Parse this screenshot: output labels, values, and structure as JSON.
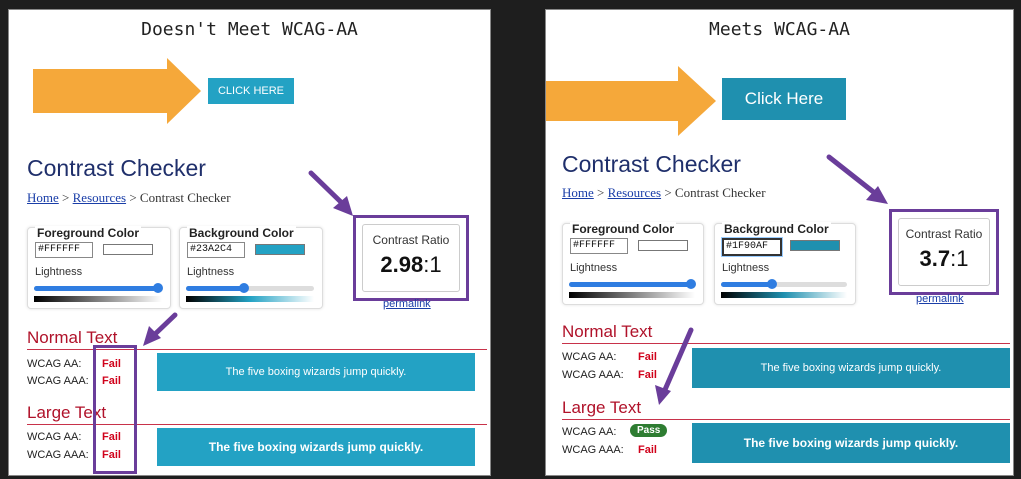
{
  "left": {
    "title": "Doesn't Meet WCAG-AA",
    "cta_label": "CLICK HERE",
    "cta_color": "#23A2C4",
    "checker": {
      "title": "Contrast Checker",
      "crumb_home": "Home",
      "crumb_sep1": " > ",
      "crumb_resources": "Resources",
      "crumb_sep2": " > ",
      "crumb_current": "Contrast Checker",
      "fg_label": "Foreground Color",
      "fg_hex": "#FFFFFF",
      "fg_lightness_label": "Lightness",
      "fg_lightness": 1.0,
      "bg_label": "Background Color",
      "bg_hex": "#23A2C4",
      "bg_lightness_label": "Lightness",
      "bg_lightness": 0.45,
      "ratio_label": "Contrast Ratio",
      "ratio_value": "2.98",
      "ratio_suffix": ":1",
      "permalink": "permalink",
      "normal_heading": "Normal Text",
      "normal_aa_label": "WCAG AA:",
      "normal_aa_result": "Fail",
      "normal_aaa_label": "WCAG AAA:",
      "normal_aaa_result": "Fail",
      "normal_sample": "The five boxing wizards jump quickly.",
      "large_heading": "Large Text",
      "large_aa_label": "WCAG AA:",
      "large_aa_result": "Fail",
      "large_aaa_label": "WCAG AAA:",
      "large_aaa_result": "Fail",
      "large_sample": "The five boxing wizards jump quickly."
    }
  },
  "right": {
    "title": "Meets WCAG-AA",
    "cta_label": "Click Here",
    "cta_color": "#1F90AF",
    "checker": {
      "title": "Contrast Checker",
      "crumb_home": "Home",
      "crumb_sep1": " > ",
      "crumb_resources": "Resources",
      "crumb_sep2": " > ",
      "crumb_current": "Contrast Checker",
      "fg_label": "Foreground Color",
      "fg_hex": "#FFFFFF",
      "fg_lightness_label": "Lightness",
      "fg_lightness": 1.0,
      "bg_label": "Background Color",
      "bg_hex": "#1F90AF",
      "bg_lightness_label": "Lightness",
      "bg_lightness": 0.4,
      "ratio_label": "Contrast Ratio",
      "ratio_value": "3.7",
      "ratio_suffix": ":1",
      "permalink": "permalink",
      "normal_heading": "Normal Text",
      "normal_aa_label": "WCAG AA:",
      "normal_aa_result": "Fail",
      "normal_aaa_label": "WCAG AAA:",
      "normal_aaa_result": "Fail",
      "normal_sample": "The five boxing wizards jump quickly.",
      "large_heading": "Large Text",
      "large_aa_label": "WCAG AA:",
      "large_aa_result": "Pass",
      "large_aaa_label": "WCAG AAA:",
      "large_aaa_result": "Fail",
      "large_sample": "The five boxing wizards jump quickly."
    }
  },
  "colors": {
    "arrow_orange": "#F5A83A",
    "annotation_purple": "#6A3D9A",
    "fail_red": "#D0021B",
    "pass_green": "#2E7D32",
    "heading_red": "#B0122A"
  }
}
